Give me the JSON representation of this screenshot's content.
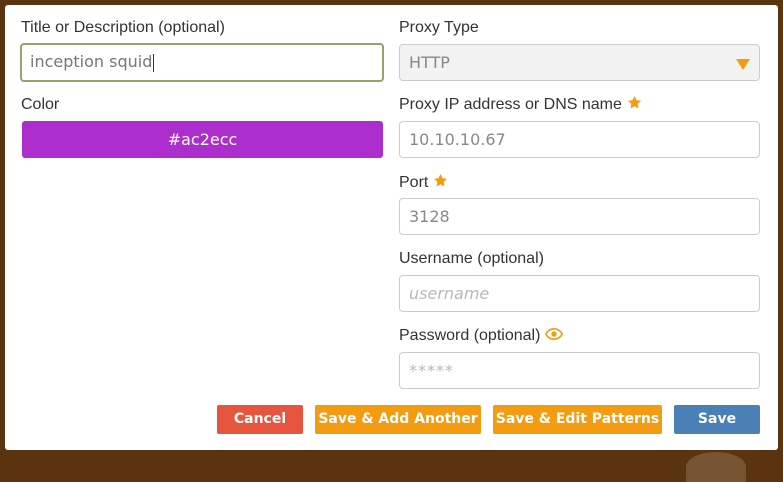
{
  "form": {
    "title_label": "Title or Description (optional)",
    "title_value": "inception squid",
    "color_label": "Color",
    "color_value": "#ac2ecc",
    "proxy_type_label": "Proxy Type",
    "proxy_type_value": "HTTP",
    "proxy_ip_label": "Proxy IP address or DNS name",
    "proxy_ip_placeholder": "10.10.10.67",
    "port_label": "Port",
    "port_placeholder": "3128",
    "username_label": "Username (optional)",
    "username_placeholder": "username",
    "password_label": "Password (optional)",
    "password_placeholder": "*****"
  },
  "buttons": {
    "cancel": "Cancel",
    "save_add_another": "Save & Add Another",
    "save_edit_patterns": "Save & Edit Patterns",
    "save": "Save"
  },
  "colors": {
    "swatch": "#ac2ecc",
    "accent_orange": "#f39c12",
    "cancel_red": "#e8553e",
    "save_blue": "#4a80b6",
    "focus_green": "#8fa56a"
  },
  "icons": {
    "required": "star-icon",
    "reveal_password": "eye-icon",
    "select_dropdown": "chevron-down-icon"
  }
}
